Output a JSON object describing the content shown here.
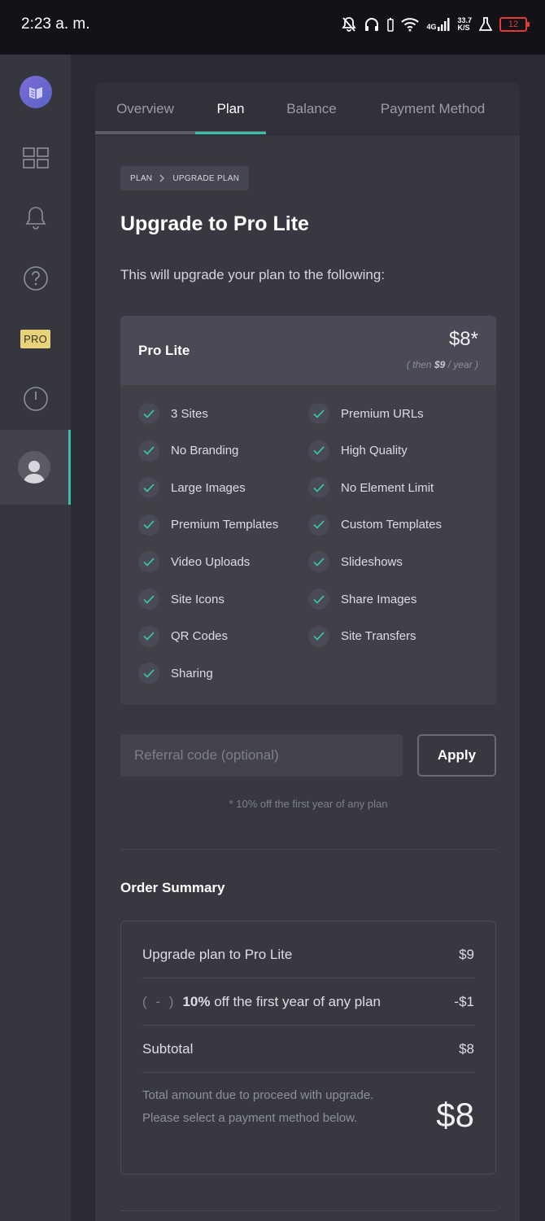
{
  "status_bar": {
    "time": "2:23 a. m.",
    "network": "4G",
    "speed_value": "33.7",
    "speed_unit": "K/S",
    "battery": "12"
  },
  "tabs": [
    {
      "label": "Overview"
    },
    {
      "label": "Plan"
    },
    {
      "label": "Balance"
    },
    {
      "label": "Payment Method"
    }
  ],
  "breadcrumb": {
    "root": "PLAN",
    "current": "UPGRADE PLAN"
  },
  "page": {
    "title": "Upgrade to Pro Lite",
    "intro": "This will upgrade your plan to the following:"
  },
  "plan": {
    "name": "Pro Lite",
    "price": "$8*",
    "then_prefix": "( then ",
    "then_price": "$9",
    "then_suffix": " / year )",
    "features_left": [
      "3 Sites",
      "No Branding",
      "Large Images",
      "Premium Templates",
      "Video Uploads",
      "Site Icons",
      "QR Codes",
      "Sharing"
    ],
    "features_right": [
      "Premium URLs",
      "High Quality",
      "No Element Limit",
      "Custom Templates",
      "Slideshows",
      "Share Images",
      "Site Transfers"
    ]
  },
  "referral": {
    "placeholder": "Referral code (optional)",
    "value": "",
    "apply_label": "Apply",
    "note": "* 10% off the first year of any plan"
  },
  "order_summary": {
    "title": "Order Summary",
    "rows": [
      {
        "label": "Upgrade plan to Pro Lite",
        "amount": "$9"
      },
      {
        "prefix": "( - )",
        "bold": "10%",
        "label": " off the first year of any plan",
        "amount": "-$1"
      },
      {
        "label": "Subtotal",
        "amount": "$8"
      }
    ],
    "total_desc": "Total amount due to proceed with upgrade. Please select a payment method below.",
    "total_amount": "$8"
  },
  "sidebar": {
    "pro_badge": "PRO"
  },
  "colors": {
    "accent": "#3bbfa8",
    "pro_badge": "#e8d27a",
    "battery_low": "#e53935"
  }
}
